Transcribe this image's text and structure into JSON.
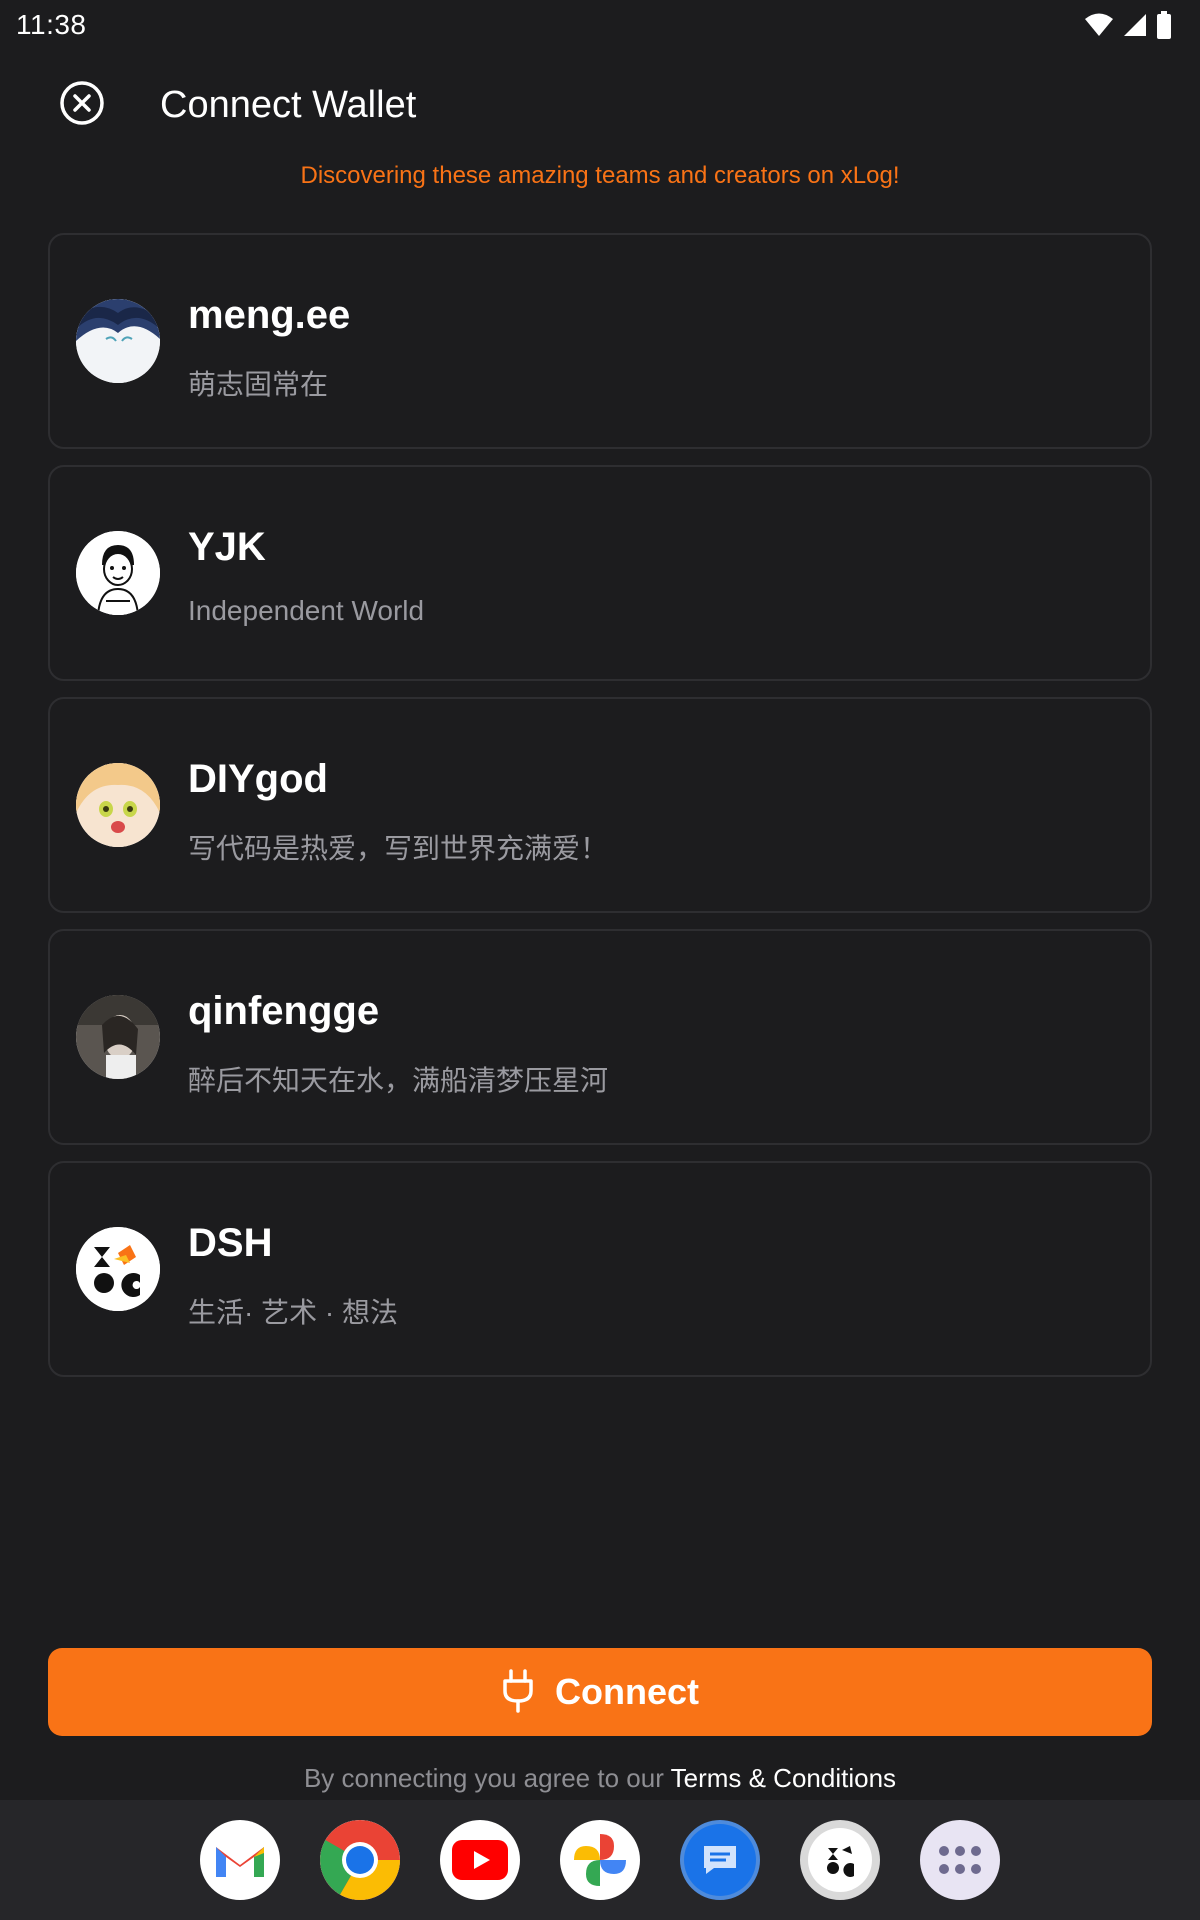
{
  "status_bar": {
    "time": "11:38",
    "icons": [
      "wifi-icon",
      "signal-icon",
      "battery-icon"
    ]
  },
  "header": {
    "title": "Connect Wallet",
    "close_icon": "close-circle-icon"
  },
  "subtitle": "Discovering these amazing teams and creators on xLog!",
  "creators": [
    {
      "name": "meng.ee",
      "description": "萌志固常在"
    },
    {
      "name": "YJK",
      "description": "Independent World"
    },
    {
      "name": "DIYgod",
      "description": "写代码是热爱，写到世界充满爱！"
    },
    {
      "name": "qinfengge",
      "description": "醉后不知天在水，满船清梦压星河"
    },
    {
      "name": "DSH",
      "description": "生活· 艺术 · 想法"
    }
  ],
  "connect_button": {
    "label": "Connect",
    "icon": "plug-icon"
  },
  "terms": {
    "prefix": "By connecting you agree to our ",
    "link": "Terms & Conditions"
  },
  "dock": {
    "apps": [
      "gmail",
      "chrome",
      "youtube",
      "photos",
      "messages",
      "xlog",
      "app-drawer"
    ]
  },
  "colors": {
    "background": "#1c1c1e",
    "accent": "#f97316",
    "card_border": "#2e2e31",
    "muted_text": "#9a9aa0"
  }
}
